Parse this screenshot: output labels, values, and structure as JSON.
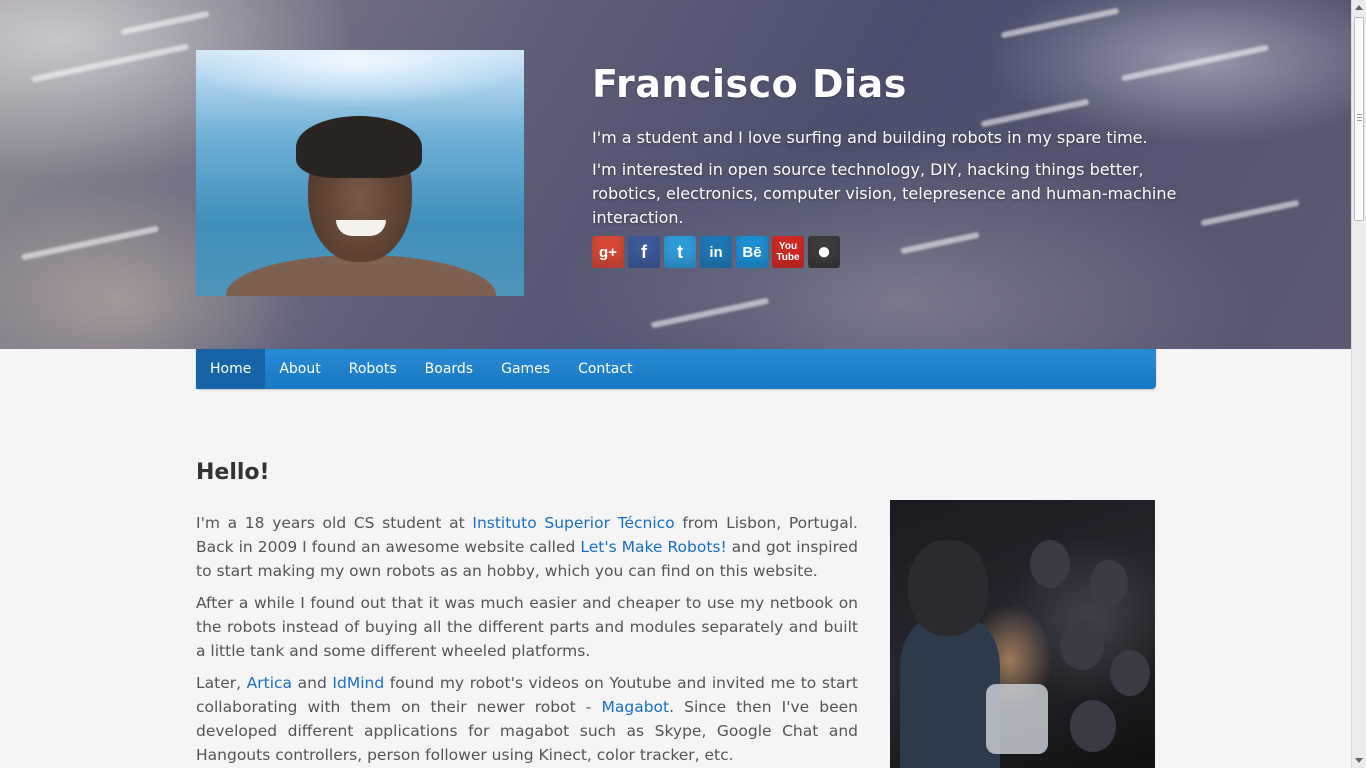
{
  "header": {
    "name": "Francisco Dias",
    "intro": "I'm a student and I love surfing and building robots in my spare time.",
    "interests": "I'm interested in open source technology, DIY, hacking things better, robotics, electronics, computer vision, telepresence and human-machine interaction.",
    "social": [
      {
        "icon": "google-plus-icon",
        "glyph": "g+",
        "color": "#d34836"
      },
      {
        "icon": "facebook-icon",
        "glyph": "f",
        "color": "#3b5998"
      },
      {
        "icon": "twitter-icon",
        "glyph": "t",
        "color": "#2e9ad8"
      },
      {
        "icon": "linkedin-icon",
        "glyph": "in",
        "color": "#1e77b5"
      },
      {
        "icon": "behance-icon",
        "glyph": "Bē",
        "color": "#1c8fd3"
      },
      {
        "icon": "youtube-icon",
        "glyph": "You Tube",
        "color": "#cc2a22"
      },
      {
        "icon": "github-icon",
        "glyph": "●",
        "color": "#3a3a3a"
      }
    ]
  },
  "nav": {
    "items": [
      "Home",
      "About",
      "Robots",
      "Boards",
      "Games",
      "Contact"
    ],
    "active": "Home"
  },
  "content": {
    "heading": "Hello!",
    "p1": {
      "t1": "I'm a 18 years old CS student at ",
      "l1": "Instituto Superior Técnico",
      "t2": " from Lisbon, Portugal. Back in 2009 I found an awesome website called ",
      "l2": "Let's Make Robots!",
      "t3": " and got inspired to start making my own robots as an hobby, which you can find on this website."
    },
    "p2": "After a while I found out that it was much easier and cheaper to use my netbook on the robots instead of buying all the different parts and modules separately and built a little tank and some different wheeled platforms.",
    "p3": {
      "t1": "Later, ",
      "l1": "Artica",
      "t2": " and ",
      "l2": "IdMind",
      "t3": " found my robot's videos on Youtube and invited me to start collaborating with them on their newer robot - ",
      "l3": "Magabot",
      "t4": ". Since then I've been developed different applications for magabot such as Skype, Google Chat and Hangouts controllers, person follower using Kinect, color tracker, etc."
    }
  }
}
